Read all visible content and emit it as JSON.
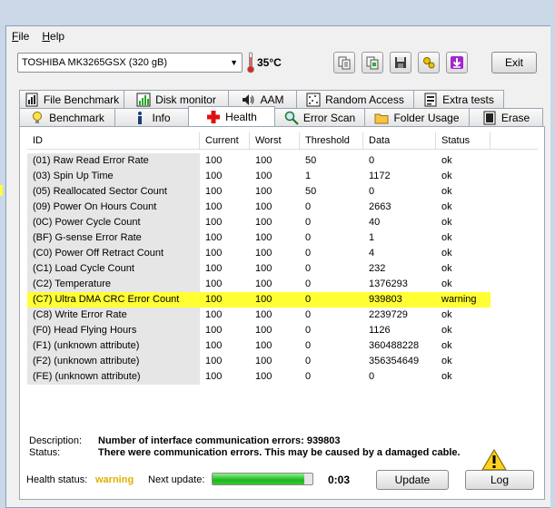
{
  "menu": {
    "file_u": "F",
    "file_rest": "ile",
    "help_u": "H",
    "help_rest": "elp"
  },
  "toolbar": {
    "drive": "TOSHIBA MK3265GSX (320 gB)",
    "temperature": "35°C",
    "exit_label": "Exit",
    "buttons": [
      "copy-text-icon",
      "copy-info-icon",
      "save-icon",
      "options-icon",
      "download-icon"
    ]
  },
  "tabs_row1": [
    {
      "label": "File Benchmark",
      "icon": "file-benchmark-icon"
    },
    {
      "label": "Disk monitor",
      "icon": "disk-monitor-icon"
    },
    {
      "label": "AAM",
      "icon": "speaker-icon"
    },
    {
      "label": "Random Access",
      "icon": "random-access-icon"
    },
    {
      "label": "Extra tests",
      "icon": "extra-tests-icon"
    }
  ],
  "tabs_row2": [
    {
      "label": "Benchmark",
      "icon": "benchmark-icon"
    },
    {
      "label": "Info",
      "icon": "info-icon"
    },
    {
      "label": "Health",
      "icon": "health-cross-icon",
      "active": true
    },
    {
      "label": "Error Scan",
      "icon": "magnifier-icon"
    },
    {
      "label": "Folder Usage",
      "icon": "folder-icon"
    },
    {
      "label": "Erase",
      "icon": "erase-icon"
    }
  ],
  "table": {
    "headers": [
      "ID",
      "Current",
      "Worst",
      "Threshold",
      "Data",
      "Status"
    ],
    "rows": [
      [
        "(01) Raw Read Error Rate",
        "100",
        "100",
        "50",
        "0",
        "ok"
      ],
      [
        "(03) Spin Up Time",
        "100",
        "100",
        "1",
        "1172",
        "ok"
      ],
      [
        "(05) Reallocated Sector Count",
        "100",
        "100",
        "50",
        "0",
        "ok"
      ],
      [
        "(09) Power On Hours Count",
        "100",
        "100",
        "0",
        "2663",
        "ok"
      ],
      [
        "(0C) Power Cycle Count",
        "100",
        "100",
        "0",
        "40",
        "ok"
      ],
      [
        "(BF) G-sense Error Rate",
        "100",
        "100",
        "0",
        "1",
        "ok"
      ],
      [
        "(C0) Power Off Retract Count",
        "100",
        "100",
        "0",
        "4",
        "ok"
      ],
      [
        "(C1) Load Cycle Count",
        "100",
        "100",
        "0",
        "232",
        "ok"
      ],
      [
        "(C2) Temperature",
        "100",
        "100",
        "0",
        "1376293",
        "ok"
      ],
      [
        "(C7) Ultra DMA CRC Error Count",
        "100",
        "100",
        "0",
        "939803",
        "warning"
      ],
      [
        "(C8) Write Error Rate",
        "100",
        "100",
        "0",
        "2239729",
        "ok"
      ],
      [
        "(F0) Head Flying Hours",
        "100",
        "100",
        "0",
        "1126",
        "ok"
      ],
      [
        "(F1) (unknown attribute)",
        "100",
        "100",
        "0",
        "360488228",
        "ok"
      ],
      [
        "(F2) (unknown attribute)",
        "100",
        "100",
        "0",
        "356354649",
        "ok"
      ],
      [
        "(FE) (unknown attribute)",
        "100",
        "100",
        "0",
        "0",
        "ok"
      ]
    ],
    "highlight_color": "#ffff33"
  },
  "details": {
    "description_label": "Description:",
    "description_value": "Number of interface communication errors: 939803",
    "status_label": "Status:",
    "status_value": "There were communication errors. This may be caused by a damaged cable."
  },
  "footer": {
    "health_label": "Health status:",
    "health_value": "warning",
    "health_color": "#e0b000",
    "next_update_label": "Next update:",
    "progress": 0.92,
    "countdown": "0:03",
    "update_label": "Update",
    "log_label": "Log"
  }
}
